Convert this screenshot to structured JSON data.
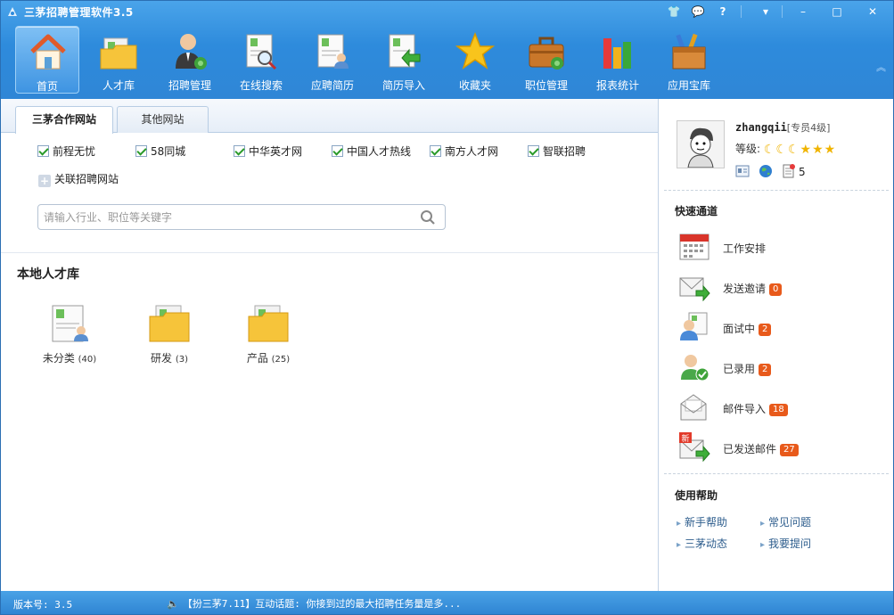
{
  "app": {
    "title": "三茅招聘管理软件3.5"
  },
  "toolbar": {
    "items": [
      {
        "label": "首页",
        "icon": "home-icon"
      },
      {
        "label": "人才库",
        "icon": "folder-icon"
      },
      {
        "label": "招聘管理",
        "icon": "recruiter-icon"
      },
      {
        "label": "在线搜索",
        "icon": "search-doc-icon"
      },
      {
        "label": "应聘简历",
        "icon": "resume-icon"
      },
      {
        "label": "简历导入",
        "icon": "import-icon"
      },
      {
        "label": "收藏夹",
        "icon": "star-icon"
      },
      {
        "label": "职位管理",
        "icon": "briefcase-icon"
      },
      {
        "label": "报表统计",
        "icon": "bar-chart-icon"
      },
      {
        "label": "应用宝库",
        "icon": "toolbox-icon"
      }
    ]
  },
  "tabs": [
    {
      "label": "三茅合作网站"
    },
    {
      "label": "其他网站"
    }
  ],
  "sites": [
    {
      "label": "前程无忧"
    },
    {
      "label": "58同城"
    },
    {
      "label": "中华英才网"
    },
    {
      "label": "中国人才热线"
    },
    {
      "label": "南方人才网"
    },
    {
      "label": "智联招聘"
    }
  ],
  "link_sites": {
    "label": "关联招聘网站"
  },
  "search": {
    "placeholder": "请输入行业、职位等关键字"
  },
  "local": {
    "title": "本地人才库",
    "folders": [
      {
        "label": "未分类",
        "count": "(40)"
      },
      {
        "label": "研发",
        "count": "(3)"
      },
      {
        "label": "产品",
        "count": "(25)"
      }
    ]
  },
  "user": {
    "name": "zhangqii",
    "rank": "[专员4级]",
    "level_label": "等级:",
    "doc_count": "5"
  },
  "quick": {
    "title": "快速通道",
    "items": [
      {
        "label": "工作安排",
        "badge": ""
      },
      {
        "label": "发送邀请",
        "badge": "0"
      },
      {
        "label": "面试中",
        "badge": "2"
      },
      {
        "label": "已录用",
        "badge": "2"
      },
      {
        "label": "邮件导入",
        "badge": "18"
      },
      {
        "label": "已发送邮件",
        "badge": "27"
      }
    ]
  },
  "help": {
    "title": "使用帮助",
    "links": [
      {
        "label": "新手帮助"
      },
      {
        "label": "常见问题"
      },
      {
        "label": "三茅动态"
      },
      {
        "label": "我要提问"
      }
    ]
  },
  "status": {
    "version": "版本号: 3.5",
    "news": "【扮三茅7.11】互动话题: 你接到过的最大招聘任务量是多..."
  },
  "colors": {
    "header": "#2e8bdc",
    "badge": "#e85a1b",
    "link": "#2d5d8d"
  }
}
